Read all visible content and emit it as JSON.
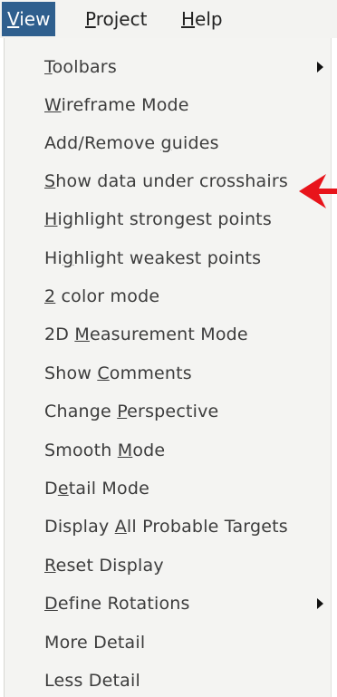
{
  "menubar": {
    "items": [
      {
        "pre": "",
        "mn": "V",
        "post": "iew",
        "active": true
      },
      {
        "pre": "",
        "mn": "P",
        "post": "roject",
        "active": false
      },
      {
        "pre": "",
        "mn": "H",
        "post": "elp",
        "active": false
      }
    ]
  },
  "view_menu": {
    "items": [
      {
        "pre": "",
        "mn": "T",
        "post": "oolbars",
        "submenu": true
      },
      {
        "pre": "",
        "mn": "W",
        "post": "ireframe Mode",
        "submenu": false
      },
      {
        "pre": "Add/Remove ",
        "mn": "g",
        "post": "uides",
        "submenu": false
      },
      {
        "pre": "",
        "mn": "S",
        "post": "how data under crosshairs",
        "submenu": false
      },
      {
        "pre": "",
        "mn": "H",
        "post": "ighlight strongest points",
        "submenu": false
      },
      {
        "pre": "Hi",
        "mn": "g",
        "post": "hlight weakest points",
        "submenu": false
      },
      {
        "pre": "",
        "mn": "2",
        "post": " color mode",
        "submenu": false
      },
      {
        "pre": "2D ",
        "mn": "M",
        "post": "easurement Mode",
        "submenu": false
      },
      {
        "pre": "Show ",
        "mn": "C",
        "post": "omments",
        "submenu": false
      },
      {
        "pre": "Change ",
        "mn": "P",
        "post": "erspective",
        "submenu": false
      },
      {
        "pre": "Smooth ",
        "mn": "M",
        "post": "ode",
        "submenu": false
      },
      {
        "pre": "D",
        "mn": "e",
        "post": "tail Mode",
        "submenu": false
      },
      {
        "pre": "Display ",
        "mn": "A",
        "post": "ll Probable Targets",
        "submenu": false
      },
      {
        "pre": "",
        "mn": "R",
        "post": "eset Display",
        "submenu": false
      },
      {
        "pre": "",
        "mn": "D",
        "post": "efine Rotations",
        "submenu": true
      },
      {
        "pre": "More Detail",
        "mn": "",
        "post": "",
        "submenu": false
      },
      {
        "pre": "Less Detail",
        "mn": "",
        "post": "",
        "submenu": false
      }
    ]
  },
  "annotation": {
    "icon": "red-arrow-icon",
    "color": "#e8141b"
  },
  "colors": {
    "menubar_active_bg": "#2f5f8e",
    "menu_bg": "#f4f4f2"
  }
}
